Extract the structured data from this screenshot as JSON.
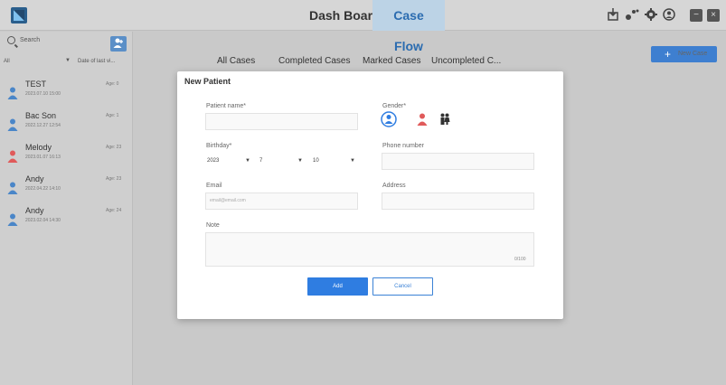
{
  "header": {
    "nav": [
      {
        "label": "Dash Board",
        "active": false
      },
      {
        "label": "Case Flow",
        "active": true
      }
    ],
    "icons": [
      "import-icon",
      "share-icon",
      "settings-icon",
      "user-icon",
      "minimize-icon",
      "close-icon"
    ]
  },
  "sidebar": {
    "search_placeholder": "Search",
    "filter_label": "All",
    "sort_label": "Date of last vi...",
    "patients": [
      {
        "name": "TEST",
        "date": "2023.07.10 15:00",
        "age": "Age: 0",
        "gender": "male"
      },
      {
        "name": "Bac Son",
        "date": "2022.12.27 12:54",
        "age": "Age: 1",
        "gender": "male"
      },
      {
        "name": "Melody",
        "date": "2023.01.07 16:13",
        "age": "Age: 23",
        "gender": "female"
      },
      {
        "name": "Andy",
        "date": "2022.04.22 14:10",
        "age": "Age: 23",
        "gender": "male"
      },
      {
        "name": "Andy",
        "date": "2023.02.04 14:30",
        "age": "Age: 24",
        "gender": "male"
      }
    ]
  },
  "main": {
    "tabs": [
      "All Cases",
      "Completed Cases",
      "Marked Cases",
      "Uncompleted C..."
    ],
    "new_case_label": "New Case"
  },
  "modal": {
    "title": "New Patient",
    "patient_name_label": "Patient name*",
    "gender_label": "Gender*",
    "birthday_label": "Birthday*",
    "birthday_year": "2023",
    "birthday_month": "7",
    "birthday_day": "10",
    "phone_label": "Phone number",
    "email_label": "Email",
    "email_placeholder": "email@email.com",
    "address_label": "Address",
    "note_label": "Note",
    "note_counter": "0/100",
    "add_label": "Add",
    "cancel_label": "Cancel"
  },
  "colors": {
    "accent": "#2f7de1",
    "male": "#4a86c8",
    "female": "#e05a5a"
  }
}
